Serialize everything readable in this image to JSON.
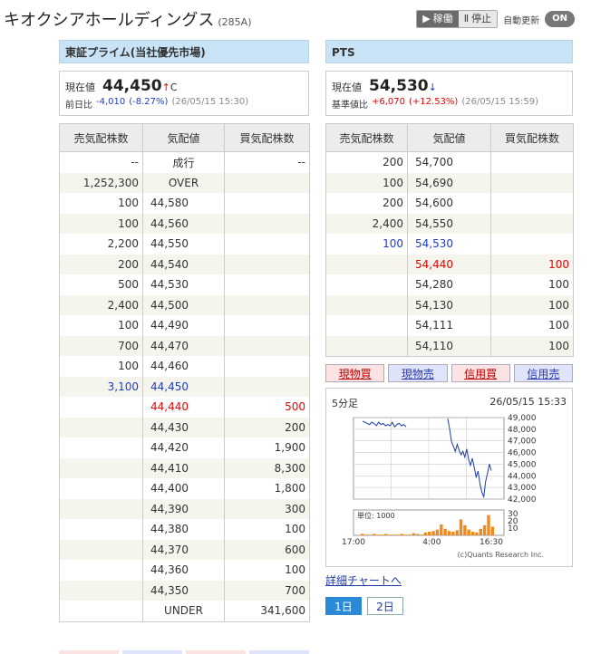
{
  "header": {
    "title": "キオクシアホールディングス",
    "code": "(285A)",
    "live_label": "稼働",
    "stop_label": "停止",
    "auto_label": "自動更新",
    "toggle_label": "ON"
  },
  "tse": {
    "title": "東証プライム(当社優先市場)",
    "price_label": "現在値",
    "price": "44,450",
    "arrow": "↑",
    "suffix": "C",
    "change_label": "前日比",
    "change": "-4,010",
    "change_pct": "(-8.27%)",
    "time": "(26/05/15 15:30)",
    "col_sell": "売気配株数",
    "col_price": "気配値",
    "col_buy": "買気配株数",
    "rows": [
      {
        "sell": "--",
        "price": "成行",
        "buy": "--"
      },
      {
        "sell": "1,252,300",
        "price": "OVER",
        "buy": ""
      },
      {
        "sell": "100",
        "price": "44,580",
        "buy": ""
      },
      {
        "sell": "100",
        "price": "44,560",
        "buy": ""
      },
      {
        "sell": "2,200",
        "price": "44,550",
        "buy": ""
      },
      {
        "sell": "200",
        "price": "44,540",
        "buy": ""
      },
      {
        "sell": "500",
        "price": "44,530",
        "buy": ""
      },
      {
        "sell": "2,400",
        "price": "44,500",
        "buy": ""
      },
      {
        "sell": "100",
        "price": "44,490",
        "buy": ""
      },
      {
        "sell": "700",
        "price": "44,470",
        "buy": ""
      },
      {
        "sell": "100",
        "price": "44,460",
        "buy": ""
      },
      {
        "sell": "3,100",
        "price": "44,450",
        "buy": ""
      },
      {
        "sell": "",
        "price": "44,440",
        "buy": "500"
      },
      {
        "sell": "",
        "price": "44,430",
        "buy": "200"
      },
      {
        "sell": "",
        "price": "44,420",
        "buy": "1,900"
      },
      {
        "sell": "",
        "price": "44,410",
        "buy": "8,300"
      },
      {
        "sell": "",
        "price": "44,400",
        "buy": "1,800"
      },
      {
        "sell": "",
        "price": "44,390",
        "buy": "300"
      },
      {
        "sell": "",
        "price": "44,380",
        "buy": "100"
      },
      {
        "sell": "",
        "price": "44,370",
        "buy": "600"
      },
      {
        "sell": "",
        "price": "44,360",
        "buy": "100"
      },
      {
        "sell": "",
        "price": "44,350",
        "buy": "700"
      },
      {
        "sell": "",
        "price": "UNDER",
        "buy": "341,600"
      }
    ]
  },
  "pts": {
    "title": "PTS",
    "price_label": "現在値",
    "price": "54,530",
    "arrow": "↓",
    "change_label": "基準値比",
    "change": "+6,070",
    "change_pct": "(+12.53%)",
    "time": "(26/05/15 15:59)",
    "col_sell": "売気配株数",
    "col_price": "気配値",
    "col_buy": "買気配株数",
    "rows": [
      {
        "sell": "200",
        "price": "54,700",
        "buy": ""
      },
      {
        "sell": "100",
        "price": "54,690",
        "buy": ""
      },
      {
        "sell": "200",
        "price": "54,600",
        "buy": ""
      },
      {
        "sell": "2,400",
        "price": "54,550",
        "buy": ""
      },
      {
        "sell": "100",
        "price": "54,530",
        "buy": ""
      },
      {
        "sell": "",
        "price": "54,440",
        "buy": "100"
      },
      {
        "sell": "",
        "price": "54,280",
        "buy": "100"
      },
      {
        "sell": "",
        "price": "54,130",
        "buy": "100"
      },
      {
        "sell": "",
        "price": "54,111",
        "buy": "100"
      },
      {
        "sell": "",
        "price": "54,110",
        "buy": "100"
      }
    ],
    "btn_cash_buy": "現物買",
    "btn_cash_sell": "現物売",
    "btn_margin_buy": "信用買",
    "btn_margin_sell": "信用売"
  },
  "chart": {
    "interval": "5分足",
    "timestamp": "26/05/15 15:33",
    "copyright": "(c)Quants Research Inc.",
    "volume_unit": "単位: 1000",
    "detail_link": "詳細チャートへ",
    "day1": "1日",
    "day2": "2日"
  },
  "chart_data": {
    "type": "line",
    "title": "",
    "xlabel": "",
    "ylabel": "",
    "x_ticks": [
      "17:00",
      "4:00",
      "16:30"
    ],
    "y_ticks": [
      "42,000",
      "43,000",
      "44,000",
      "45,000",
      "46,000",
      "47,000",
      "48,000",
      "49,000"
    ],
    "ylim": [
      42000,
      49000
    ],
    "volume_ticks": [
      "10",
      "20",
      "30"
    ],
    "volume_ylim": [
      0,
      35
    ],
    "series": [
      {
        "values": [
          48700,
          48600,
          48500,
          48400,
          48600,
          48500,
          48300,
          48600,
          48400,
          48500,
          48300,
          48400,
          48300,
          48600,
          48200,
          48400,
          48500,
          48300,
          48400,
          48200
        ]
      },
      {
        "values": [
          48900,
          48000,
          46900,
          46500,
          46100,
          46700,
          46200,
          45800,
          46100,
          45600,
          46300,
          45400,
          44900,
          45500,
          44700,
          43900,
          44400,
          43300,
          42600,
          42200,
          43500,
          44200,
          45000,
          44450
        ]
      }
    ],
    "volume": {
      "values": [
        2,
        1,
        1,
        2,
        1,
        1,
        2,
        1,
        1,
        1,
        2,
        1,
        1,
        3,
        2,
        1,
        4,
        5,
        6,
        8,
        15,
        9,
        6,
        5,
        7,
        22,
        14,
        8,
        5,
        4,
        9,
        14,
        28,
        12
      ]
    }
  }
}
